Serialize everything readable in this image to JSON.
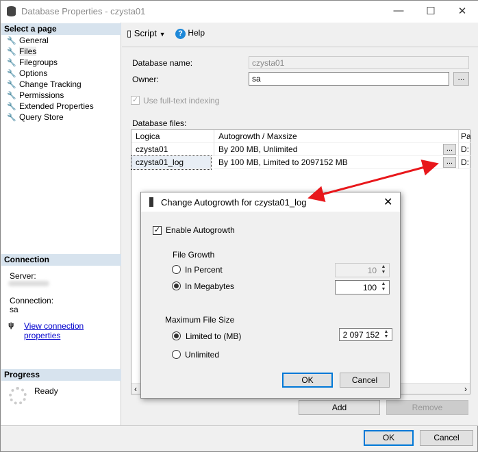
{
  "window": {
    "title": "Database Properties - czysta01",
    "icon": "database-icon"
  },
  "left": {
    "select_header": "Select a page",
    "items": [
      {
        "label": "General"
      },
      {
        "label": "Files"
      },
      {
        "label": "Filegroups"
      },
      {
        "label": "Options"
      },
      {
        "label": "Change Tracking"
      },
      {
        "label": "Permissions"
      },
      {
        "label": "Extended Properties"
      },
      {
        "label": "Query Store"
      }
    ],
    "connection_header": "Connection",
    "server_label": "Server:",
    "connection_label": "Connection:",
    "connection_value": "sa",
    "view_link": "View connection properties",
    "progress_header": "Progress",
    "progress_status": "Ready"
  },
  "toolbar": {
    "script": "Script",
    "help": "Help"
  },
  "form": {
    "dbname_label": "Database name:",
    "dbname_value": "czysta01",
    "owner_label": "Owner:",
    "owner_value": "sa",
    "browse": "...",
    "fulltext_label": "Use full-text indexing",
    "files_label": "Database files:",
    "columns": [
      "Logica",
      "Autogrowth / Maxsize",
      "Pa"
    ],
    "rows": [
      {
        "logical": "czysta01",
        "autogrowth": "By 200 MB, Unlimited",
        "btn": "...",
        "path": "D:"
      },
      {
        "logical": "czysta01_log",
        "autogrowth": "By 100 MB, Limited to 2097152 MB",
        "btn": "...",
        "path": "D:"
      }
    ],
    "add": "Add",
    "remove": "Remove"
  },
  "footer": {
    "ok": "OK",
    "cancel": "Cancel"
  },
  "dialog": {
    "title": "Change Autogrowth for czysta01_log",
    "enable_label": "Enable Autogrowth",
    "enable_checked": true,
    "file_growth": "File Growth",
    "in_percent": "In Percent",
    "percent_value": "10",
    "in_mb": "In Megabytes",
    "mb_value": "100",
    "growth_selected": "In Megabytes",
    "max_size": "Maximum File Size",
    "limited": "Limited to (MB)",
    "limited_value": "2 097 152",
    "unlimited": "Unlimited",
    "max_selected": "Limited to (MB)",
    "ok": "OK",
    "cancel": "Cancel"
  },
  "annotation_color": "#e8171b"
}
